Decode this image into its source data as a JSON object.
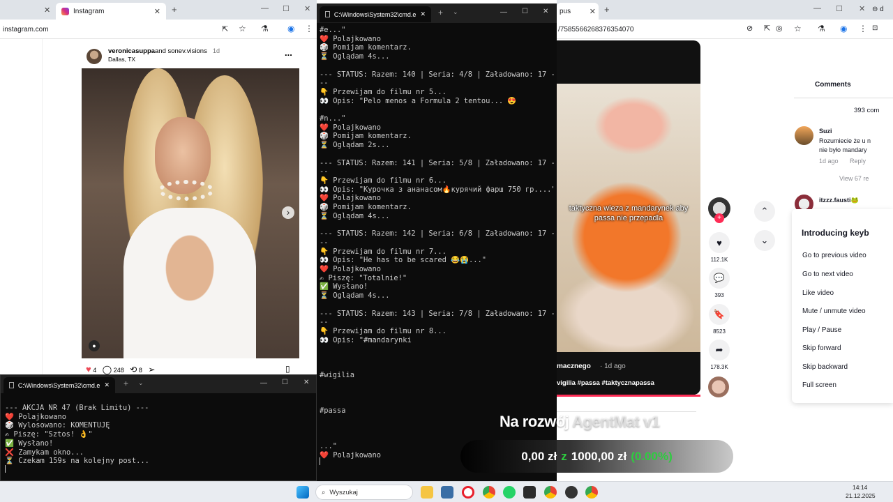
{
  "instagram": {
    "tab_label": "Instagram",
    "url": "instagram.com",
    "post_author": "veronicasuppa",
    "coauthor_text": "and sonev.visions",
    "age": "1d",
    "location": "Dallas, TX",
    "likes": "4",
    "comments": "248",
    "shares": "8",
    "more": "...",
    "next_arrow": "›"
  },
  "cmd_main": {
    "title": "C:\\Windows\\System32\\cmd.e",
    "lines": [
      "#e...\"",
      "❤️ Polajkowano",
      "🎲 Pomijam komentarz.",
      "⏳ Oglądam 4s...",
      "",
      "--- STATUS: Razem: 140 | Seria: 4/8 | Załadowano: 17 -",
      "--",
      "👇 Przewijam do filmu nr 5...",
      "👀 Opis: \"Pelo menos a Formula 2 tentou... 😍",
      "",
      "#n...\"",
      "❤️ Polajkowano",
      "🎲 Pomijam komentarz.",
      "⏳ Oglądam 2s...",
      "",
      "--- STATUS: Razem: 141 | Seria: 5/8 | Załadowano: 17 -",
      "--",
      "👇 Przewijam do filmu nr 6...",
      "👀 Opis: \"Курочка з ананасом🔥курячий фарш 750 гр....\"",
      "❤️ Polajkowano",
      "🎲 Pomijam komentarz.",
      "⏳ Oglądam 4s...",
      "",
      "--- STATUS: Razem: 142 | Seria: 6/8 | Załadowano: 17 -",
      "--",
      "👇 Przewijam do filmu nr 7...",
      "👀 Opis: \"He has to be scared 😂😭...\"",
      "❤️ Polajkowano",
      "✍ Piszę: \"Totalnie!\"",
      "✅ Wysłano!",
      "⏳ Oglądam 4s...",
      "",
      "--- STATUS: Razem: 143 | Seria: 7/8 | Załadowano: 17 -",
      "--",
      "👇 Przewijam do filmu nr 8...",
      "👀 Opis: \"#mandarynki",
      "",
      "",
      "",
      "#wigilia",
      "",
      "",
      "",
      "#passa",
      "",
      "",
      "",
      "...\"",
      "❤️ Polajkowano"
    ]
  },
  "cmd_small": {
    "title": "C:\\Windows\\System32\\cmd.e",
    "lines": [
      "--- AKCJA NR 47 (Brak Limitu) ---",
      "❤️ Polajkowano",
      "🎲 Wylosowano: KOMENTUJĘ",
      "✍ Piszę: \"Sztos! 👌\"",
      "✅ Wysłano!",
      "❌ Zamykam okno...",
      "⏳ Czekam 159s na kolejny post..."
    ]
  },
  "tiktok": {
    "tab_label": "pus",
    "url": "/7585566268376354070",
    "caption": "taktyczna wieza z mandarynek aby passa nie przepadla",
    "author_partial": "macznego",
    "age": "· 1d ago",
    "hashtags": "vigilia #passa #taktycznapassa",
    "likes": "112.1K",
    "comments": "393",
    "bookmarks": "8523",
    "shares": "178.3K",
    "comments_tab": "Comments",
    "comments_count": "393 com",
    "comment1_user": "Suzi",
    "comment1_text1": "Rozumiecie że u n",
    "comment1_text2": "nie było mandary",
    "comment1_age": "1d ago",
    "comment1_reply": "Reply",
    "view_replies": "View 67 re",
    "comment2_user": "itzzz.fausti🐸",
    "kb_title": "Introducing keyb",
    "kb_items": [
      "Go to previous video",
      "Go to next video",
      "Like video",
      "Mute / unmute video",
      "Play / Pause",
      "Skip forward",
      "Skip backward",
      "Full screen"
    ]
  },
  "overlay": {
    "title_main": "Na rozwój ",
    "title_faded": "AgentMat v1",
    "amount_current": "0,00 zł",
    "amount_sep": "z",
    "amount_goal": "1000,00 zł",
    "percent": "(0.00%)",
    "percent_color": "#2ecc40"
  },
  "taskbar": {
    "search_label": "Wyszukaj",
    "time": "14:14",
    "date": "21.12.2025"
  }
}
